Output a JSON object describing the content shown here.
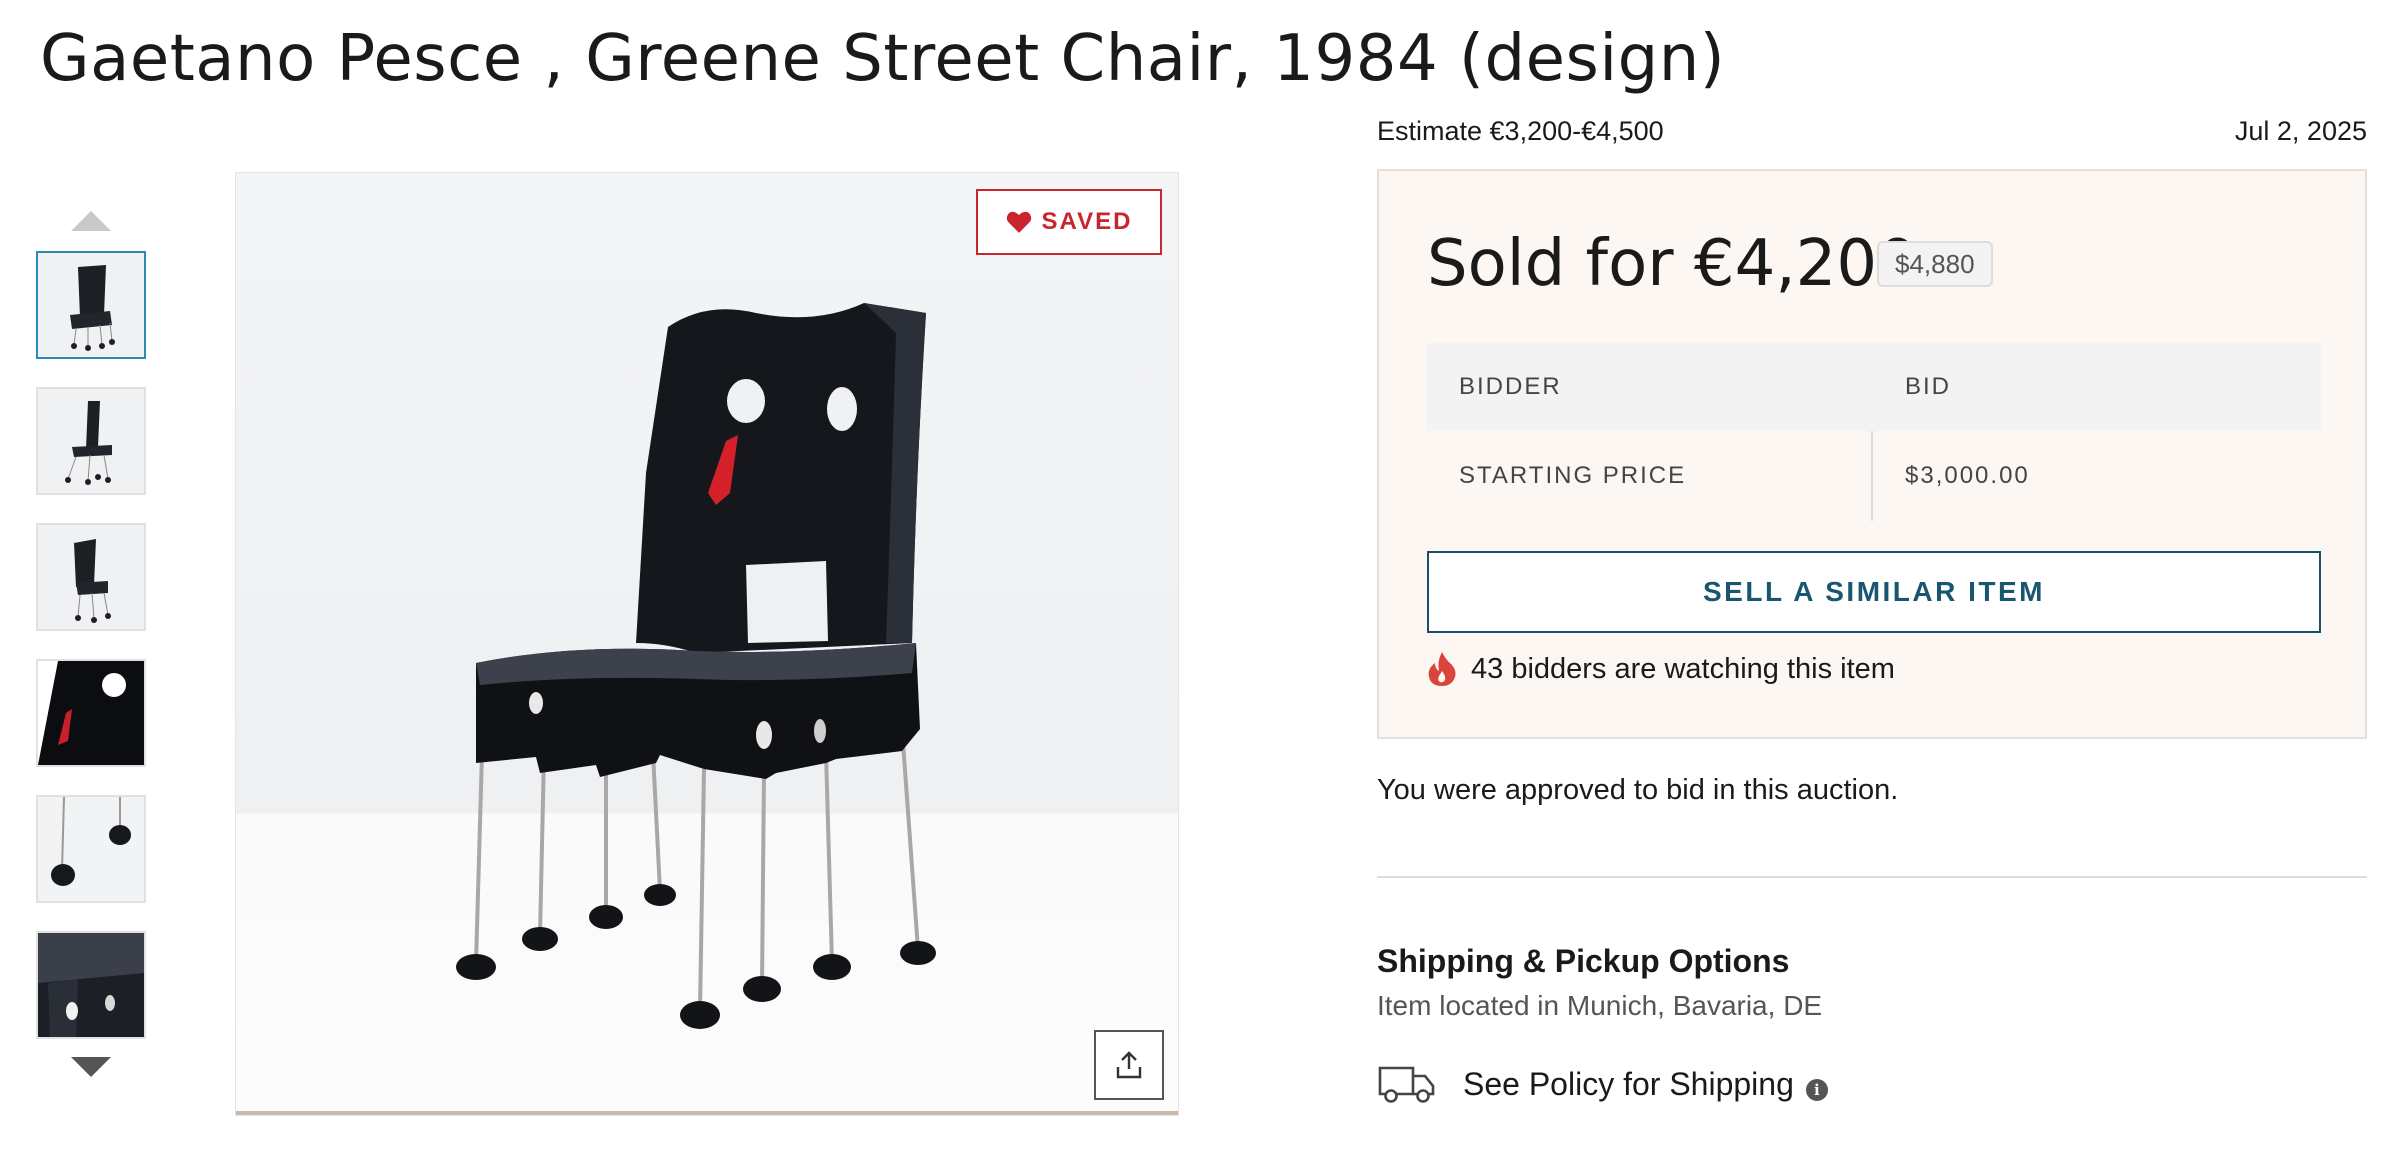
{
  "lot": {
    "title": "Gaetano Pesce , Greene Street Chair, 1984 (design)"
  },
  "gallery": {
    "saved_label": "SAVED",
    "thumbnail_count": 6,
    "active_thumbnail": 1
  },
  "auction": {
    "estimate": "Estimate €3,200-€4,500",
    "date": "Jul 2, 2025",
    "sold_label": "Sold for €4,200",
    "usd_price": "$4,880",
    "table": {
      "headers": [
        "BIDDER",
        "BID"
      ],
      "rows": [
        {
          "bidder": "STARTING PRICE",
          "bid": "$3,000.00"
        }
      ]
    },
    "sell_button": "SELL A SIMILAR ITEM",
    "watching_text": "43 bidders are watching this item",
    "approved_text": "You were approved to bid in this auction."
  },
  "shipping": {
    "title": "Shipping & Pickup Options",
    "location": "Item located in Munich, Bavaria, DE",
    "policy_link": "See Policy for Shipping"
  },
  "colors": {
    "accent_red": "#c8252c",
    "accent_blue": "#1a5670",
    "sold_box_bg": "#fcf7f3"
  }
}
